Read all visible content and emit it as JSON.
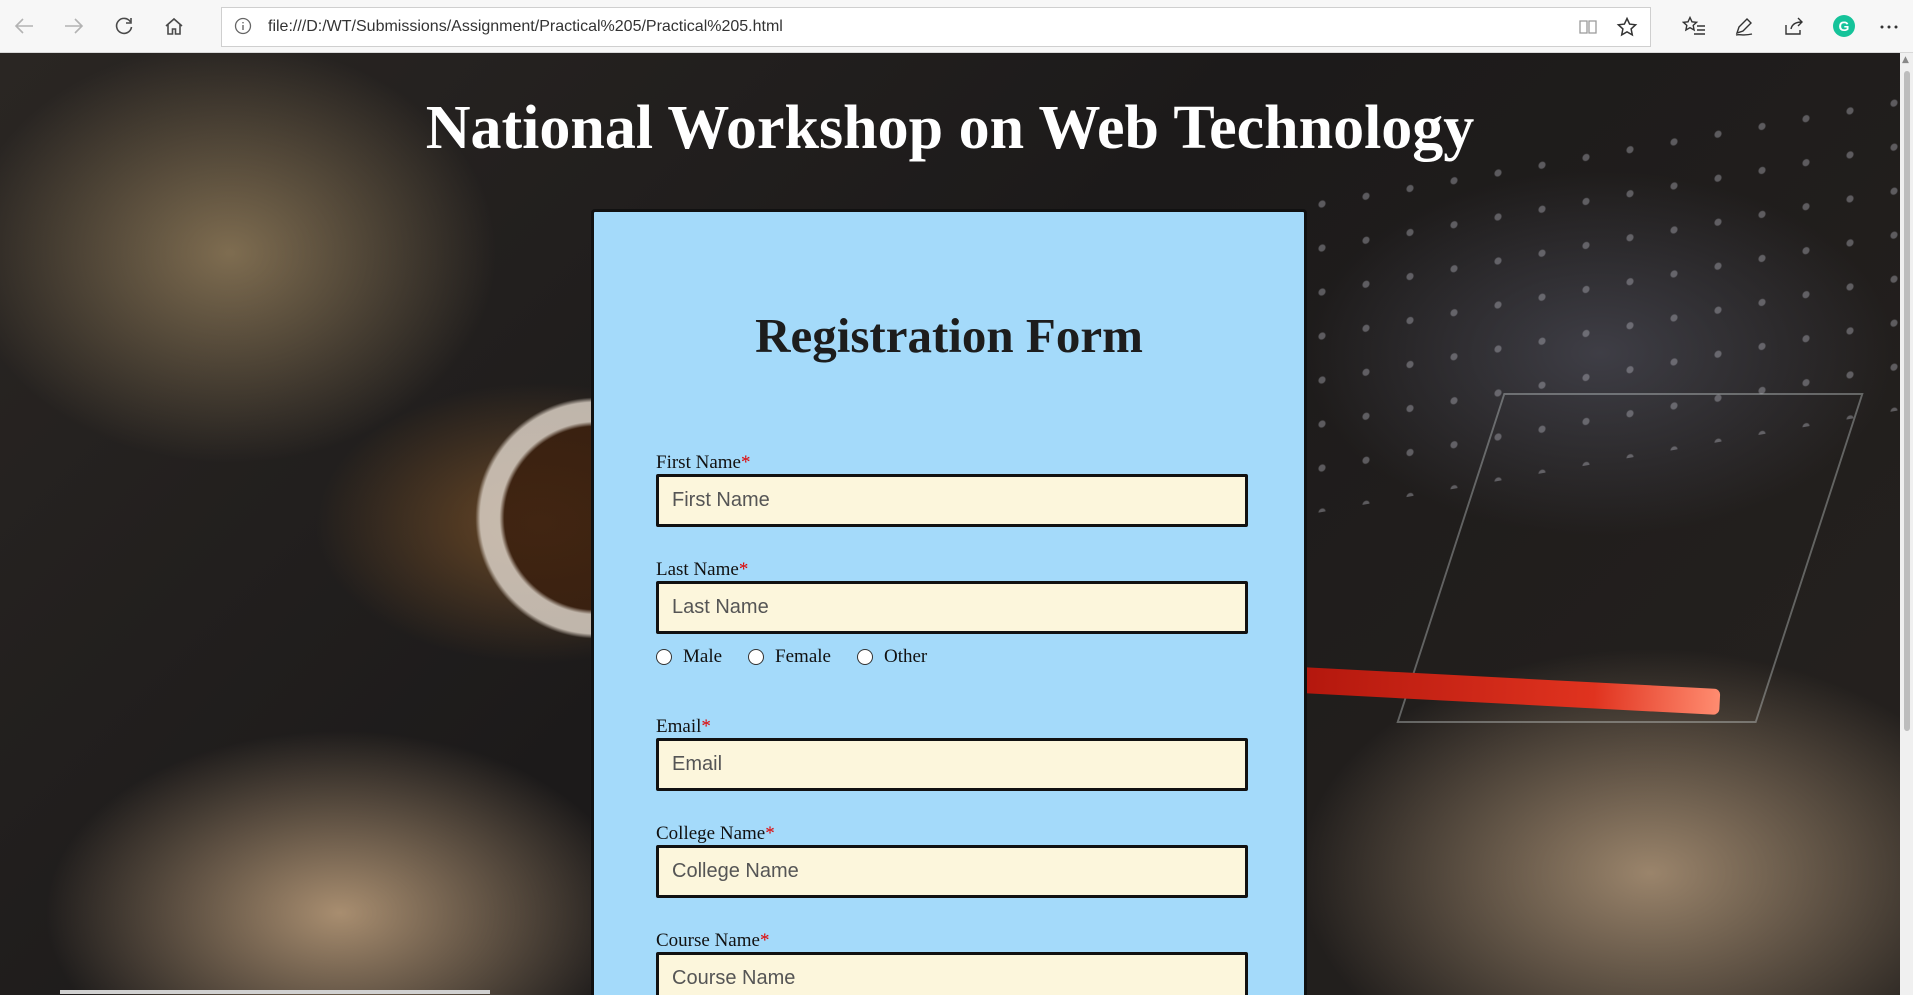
{
  "browser": {
    "url": "file:///D:/WT/Submissions/Assignment/Practical%205/Practical%205.html",
    "grammarly_letter": "G"
  },
  "page": {
    "heading": "National Workshop on Web Technology"
  },
  "form": {
    "title": "Registration Form",
    "required_mark": "*",
    "first_name": {
      "label": "First Name",
      "placeholder": "First Name"
    },
    "last_name": {
      "label": "Last Name",
      "placeholder": "Last Name"
    },
    "gender": {
      "options": [
        "Male",
        "Female",
        "Other"
      ]
    },
    "email": {
      "label": "Email",
      "placeholder": "Email"
    },
    "college": {
      "label": "College Name",
      "placeholder": "College Name"
    },
    "course": {
      "label": "Course Name",
      "placeholder": "Course Name"
    }
  },
  "colors": {
    "card_background": "#a4dafa",
    "input_background": "#fcf6dc",
    "required": "#e00000"
  }
}
